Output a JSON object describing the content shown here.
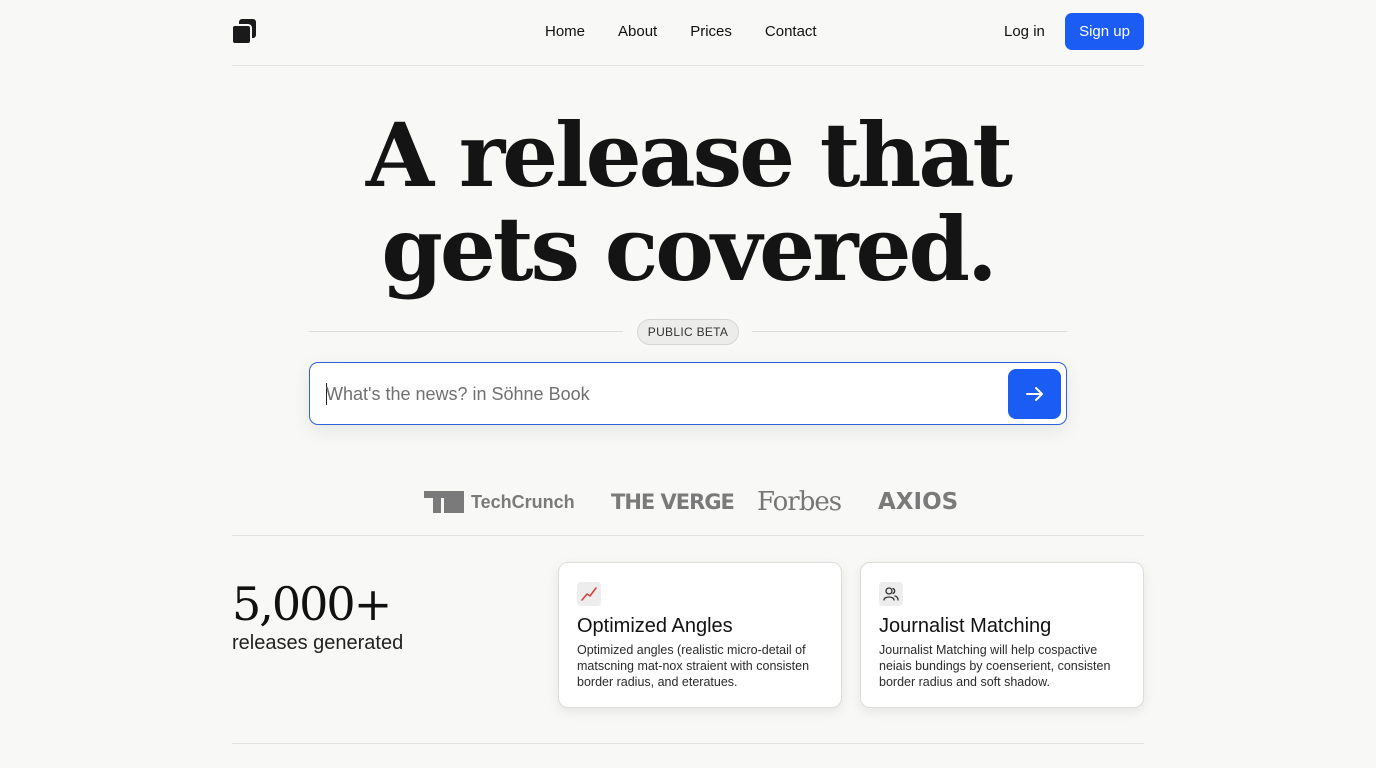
{
  "nav": {
    "links": [
      "Home",
      "About",
      "Prices",
      "Contact"
    ],
    "login": "Log in",
    "signup": "Sign up"
  },
  "hero": {
    "title_line1": "A release that",
    "title_line2": "gets covered.",
    "badge": "PUBLIC BETA",
    "search_placeholder": "What's the news? in Söhne Book"
  },
  "press_logos": [
    "TechCrunch",
    "THE VERGE",
    "Forbes",
    "AXIOS"
  ],
  "stats": {
    "number": "5,000+",
    "label": "releases generated"
  },
  "features": [
    {
      "icon": "chart-trend-icon",
      "title": "Optimized Angles",
      "description": "Optimized angles (realistic micro-detail of matscning mat-nox straient with consisten border radius, and eteratues."
    },
    {
      "icon": "users-icon",
      "title": "Journalist Matching",
      "description": "Journalist Matching will help cospactive neiais bundings by coenserient, consisten border radius and soft shadow."
    }
  ],
  "colors": {
    "accent": "#1b5cf5",
    "background": "#f8f8f7",
    "logo_gray": "#7a7a7a"
  }
}
